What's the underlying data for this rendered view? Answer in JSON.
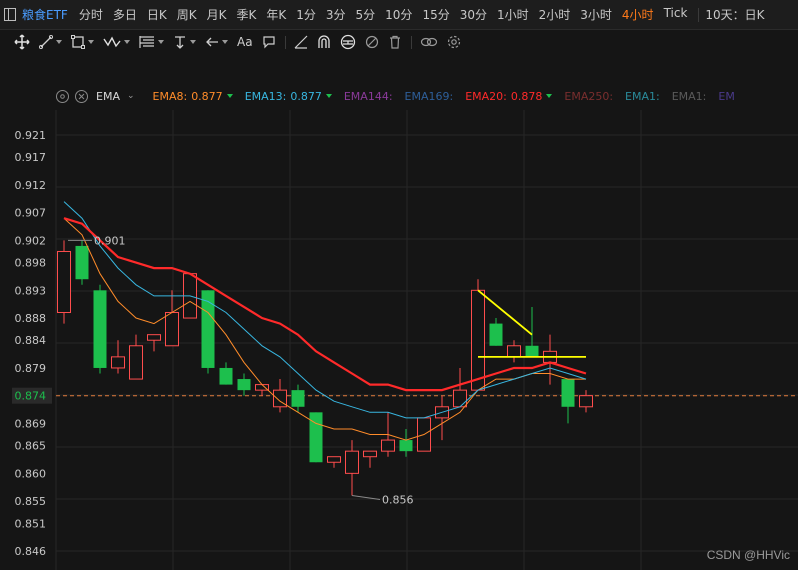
{
  "toolbar": {
    "symbol": "粮食ETF",
    "periods": [
      "分时",
      "多日",
      "日K",
      "周K",
      "月K",
      "季K",
      "年K",
      "1分",
      "3分",
      "5分",
      "10分",
      "15分",
      "30分",
      "1小时",
      "2小时",
      "3小时",
      "4小时",
      "Tick"
    ],
    "active_period": "4小时",
    "more_periods": "10天：日K"
  },
  "drawing_tools": {
    "font_label": "Aa"
  },
  "legend": {
    "indicator": "EMA",
    "items": [
      {
        "name": "EMA8:",
        "value": "0.877",
        "color": "#ff8c2a",
        "arrow": true
      },
      {
        "name": "EMA13:",
        "value": "0.877",
        "color": "#38b6e0",
        "arrow": true
      },
      {
        "name": "EMA144:",
        "value": "",
        "color": "#8a3a9a",
        "arrow": false
      },
      {
        "name": "EMA169:",
        "value": "",
        "color": "#2e5f9a",
        "arrow": false
      },
      {
        "name": "EMA20:",
        "value": "0.878",
        "color": "#ff2a2a",
        "arrow": true
      },
      {
        "name": "EMA250:",
        "value": "",
        "color": "#7a2e2e",
        "arrow": false
      },
      {
        "name": "EMA1:",
        "value": "",
        "color": "#2a8a9a",
        "arrow": false
      },
      {
        "name": "EMA1:",
        "value": "",
        "color": "#5a5a5a",
        "arrow": false
      },
      {
        "name": "EM",
        "value": "",
        "color": "#4a3a8a",
        "arrow": false
      }
    ]
  },
  "chart_data": {
    "type": "candlestick",
    "y_ticks": [
      "0.921",
      "0.917",
      "0.912",
      "0.907",
      "0.902",
      "0.898",
      "0.893",
      "0.888",
      "0.884",
      "0.879",
      "0.874",
      "0.869",
      "0.865",
      "0.860",
      "0.855",
      "0.851",
      "0.846"
    ],
    "ylim": [
      0.846,
      0.921
    ],
    "current_price": "0.874",
    "high_label": "0.901",
    "low_label": "0.856",
    "candles": [
      {
        "o": 0.889,
        "h": 0.902,
        "l": 0.887,
        "c": 0.9
      },
      {
        "o": 0.901,
        "h": 0.902,
        "l": 0.894,
        "c": 0.895
      },
      {
        "o": 0.893,
        "h": 0.894,
        "l": 0.878,
        "c": 0.879
      },
      {
        "o": 0.879,
        "h": 0.884,
        "l": 0.878,
        "c": 0.881
      },
      {
        "o": 0.877,
        "h": 0.885,
        "l": 0.877,
        "c": 0.883
      },
      {
        "o": 0.884,
        "h": 0.885,
        "l": 0.882,
        "c": 0.885
      },
      {
        "o": 0.883,
        "h": 0.893,
        "l": 0.883,
        "c": 0.889
      },
      {
        "o": 0.888,
        "h": 0.896,
        "l": 0.888,
        "c": 0.896
      },
      {
        "o": 0.893,
        "h": 0.893,
        "l": 0.878,
        "c": 0.879
      },
      {
        "o": 0.879,
        "h": 0.88,
        "l": 0.876,
        "c": 0.876
      },
      {
        "o": 0.877,
        "h": 0.878,
        "l": 0.874,
        "c": 0.875
      },
      {
        "o": 0.875,
        "h": 0.876,
        "l": 0.874,
        "c": 0.876
      },
      {
        "o": 0.872,
        "h": 0.877,
        "l": 0.871,
        "c": 0.875
      },
      {
        "o": 0.875,
        "h": 0.876,
        "l": 0.871,
        "c": 0.872
      },
      {
        "o": 0.871,
        "h": 0.871,
        "l": 0.862,
        "c": 0.862
      },
      {
        "o": 0.862,
        "h": 0.863,
        "l": 0.861,
        "c": 0.863
      },
      {
        "o": 0.86,
        "h": 0.866,
        "l": 0.856,
        "c": 0.864
      },
      {
        "o": 0.863,
        "h": 0.864,
        "l": 0.861,
        "c": 0.864
      },
      {
        "o": 0.864,
        "h": 0.871,
        "l": 0.863,
        "c": 0.866
      },
      {
        "o": 0.866,
        "h": 0.868,
        "l": 0.863,
        "c": 0.864
      },
      {
        "o": 0.864,
        "h": 0.87,
        "l": 0.864,
        "c": 0.87
      },
      {
        "o": 0.87,
        "h": 0.874,
        "l": 0.866,
        "c": 0.872
      },
      {
        "o": 0.872,
        "h": 0.879,
        "l": 0.872,
        "c": 0.875
      },
      {
        "o": 0.875,
        "h": 0.895,
        "l": 0.875,
        "c": 0.893
      },
      {
        "o": 0.887,
        "h": 0.888,
        "l": 0.883,
        "c": 0.883
      },
      {
        "o": 0.881,
        "h": 0.884,
        "l": 0.88,
        "c": 0.883
      },
      {
        "o": 0.883,
        "h": 0.89,
        "l": 0.881,
        "c": 0.881
      },
      {
        "o": 0.88,
        "h": 0.885,
        "l": 0.876,
        "c": 0.882
      },
      {
        "o": 0.877,
        "h": 0.877,
        "l": 0.869,
        "c": 0.872
      },
      {
        "o": 0.872,
        "h": 0.875,
        "l": 0.871,
        "c": 0.874
      }
    ],
    "ema8": [
      0.906,
      0.903,
      0.896,
      0.891,
      0.888,
      0.887,
      0.889,
      0.891,
      0.889,
      0.885,
      0.88,
      0.876,
      0.873,
      0.871,
      0.869,
      0.868,
      0.868,
      0.867,
      0.867,
      0.866,
      0.867,
      0.869,
      0.871,
      0.875,
      0.877,
      0.877,
      0.878,
      0.878,
      0.877,
      0.877
    ],
    "ema13": [
      0.909,
      0.906,
      0.901,
      0.897,
      0.894,
      0.892,
      0.892,
      0.892,
      0.891,
      0.889,
      0.886,
      0.883,
      0.881,
      0.878,
      0.875,
      0.873,
      0.872,
      0.871,
      0.871,
      0.87,
      0.87,
      0.871,
      0.872,
      0.875,
      0.876,
      0.877,
      0.878,
      0.879,
      0.878,
      0.877
    ],
    "ema20": [
      0.906,
      0.905,
      0.902,
      0.899,
      0.898,
      0.897,
      0.897,
      0.896,
      0.894,
      0.892,
      0.89,
      0.888,
      0.887,
      0.885,
      0.882,
      0.88,
      0.878,
      0.876,
      0.876,
      0.875,
      0.875,
      0.875,
      0.876,
      0.877,
      0.878,
      0.879,
      0.879,
      0.88,
      0.879,
      0.878
    ],
    "drawings": [
      {
        "type": "trendline",
        "color": "#ffff00",
        "from": [
          23,
          0.893
        ],
        "to": [
          26,
          0.885
        ]
      },
      {
        "type": "hline",
        "color": "#ffff00",
        "from": [
          23,
          0.881
        ],
        "to": [
          29,
          0.881
        ]
      }
    ]
  },
  "watermark": "CSDN @HHVic",
  "colors": {
    "up": "#ff4d4d",
    "down": "#1dbf4d",
    "grid": "#262626",
    "price_line": "#e07a3a"
  }
}
